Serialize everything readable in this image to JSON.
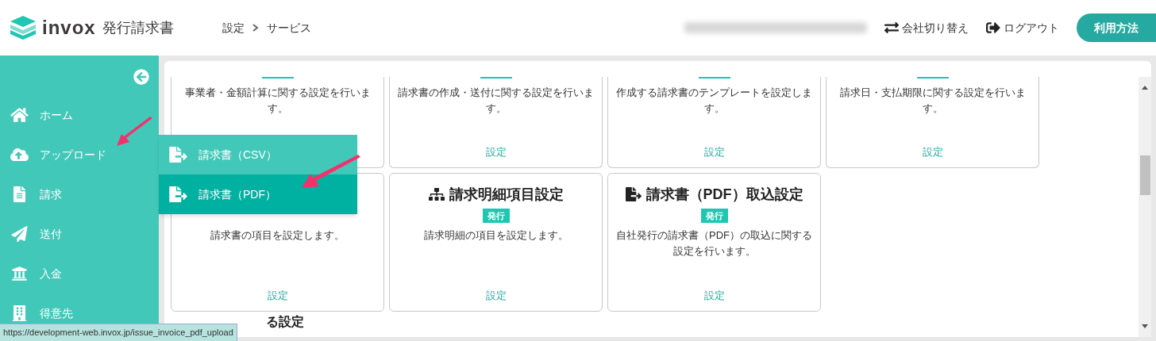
{
  "header": {
    "logo_text": "invox",
    "product": "発行請求書",
    "breadcrumb": [
      "設定",
      "サービス"
    ],
    "actions": [
      {
        "label": "会社切り替え"
      },
      {
        "label": "ログアウト"
      }
    ],
    "help_button": "利用方法"
  },
  "sidebar": {
    "items": [
      {
        "label": "ホーム"
      },
      {
        "label": "アップロード"
      },
      {
        "label": "請求"
      },
      {
        "label": "送付"
      },
      {
        "label": "入金"
      },
      {
        "label": "得意先"
      }
    ]
  },
  "flyout": {
    "items": [
      {
        "label": "請求書（CSV）",
        "selected": false
      },
      {
        "label": "請求書（PDF）",
        "selected": true
      }
    ]
  },
  "cards_top": [
    {
      "description": "事業者・金額計算に関する設定を行います。"
    },
    {
      "description": "請求書の作成・送付に関する設定を行います。",
      "link": "設定"
    },
    {
      "description": "作成する請求書のテンプレートを設定します。",
      "link": "設定"
    },
    {
      "description": "請求日・支払期限に関する設定を行います。",
      "link": "設定"
    }
  ],
  "cards": [
    {
      "description": "請求書の項目を設定します。",
      "link": "設定"
    },
    {
      "title": "請求明細項目設定",
      "badge": "発行",
      "description": "請求明細の項目を設定します。",
      "link": "設定"
    },
    {
      "title": "請求書（PDF）取込設定",
      "badge": "発行",
      "description": "自社発行の請求書（PDF）の取込に関する設定を行います。",
      "link": "設定"
    }
  ],
  "section_heading": "る設定",
  "status_url": "https://development-web.invox.jp/issue_invoice_pdf_upload"
}
